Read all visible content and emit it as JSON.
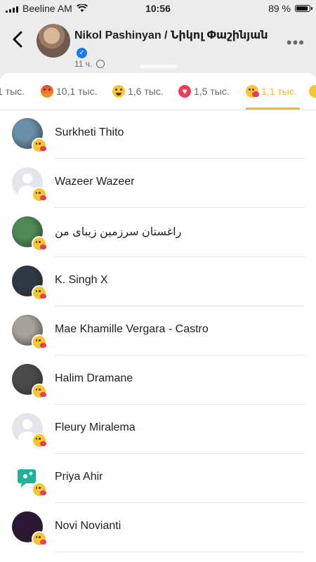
{
  "status_bar": {
    "carrier": "Beeline AM",
    "time": "10:56",
    "battery_text": "89 %",
    "battery_level": 0.89
  },
  "post": {
    "page_name": "Nikol Pashinyan / Նիկոլ Փաշինյան",
    "time_ago": "11 ч."
  },
  "reaction_tabs": [
    {
      "count": "1 тыс.",
      "icon": "reaction-partial"
    },
    {
      "count": "10,1 тыс.",
      "icon": "angry-reaction-icon"
    },
    {
      "count": "1,6 тыс.",
      "icon": "haha-reaction-icon"
    },
    {
      "count": "1,5 тыс.",
      "icon": "love-reaction-icon"
    },
    {
      "count": "1,1 тыс.",
      "icon": "care-reaction-icon",
      "active": true
    }
  ],
  "users": [
    {
      "name": "Surkheti Thito",
      "avatar": "photo",
      "avatar_color": "#6a8fa8"
    },
    {
      "name": "Wazeer Wazeer",
      "avatar": "default"
    },
    {
      "name": "راغستان سرزمین زیبای من",
      "avatar": "photo",
      "avatar_color": "#4f8a55"
    },
    {
      "name": "K. Singh X",
      "avatar": "photo",
      "avatar_color": "#2d3a45"
    },
    {
      "name": "Mae Khamille Vergara - Castro",
      "avatar": "photo",
      "avatar_color": "#a7a29b"
    },
    {
      "name": "Halim Dramane",
      "avatar": "photo",
      "avatar_color": "#4a4a4a"
    },
    {
      "name": "Fleury Miralema",
      "avatar": "default"
    },
    {
      "name": "Priya Ahir",
      "avatar": "chat-bubble",
      "avatar_color": "#1fb39a"
    },
    {
      "name": "Novi Novianti",
      "avatar": "photo",
      "avatar_color": "#2b1633"
    }
  ],
  "colors": {
    "accent_active_tab": "#f7b928",
    "verified_blue": "#1877f2",
    "care_heart": "#e83b5e"
  }
}
